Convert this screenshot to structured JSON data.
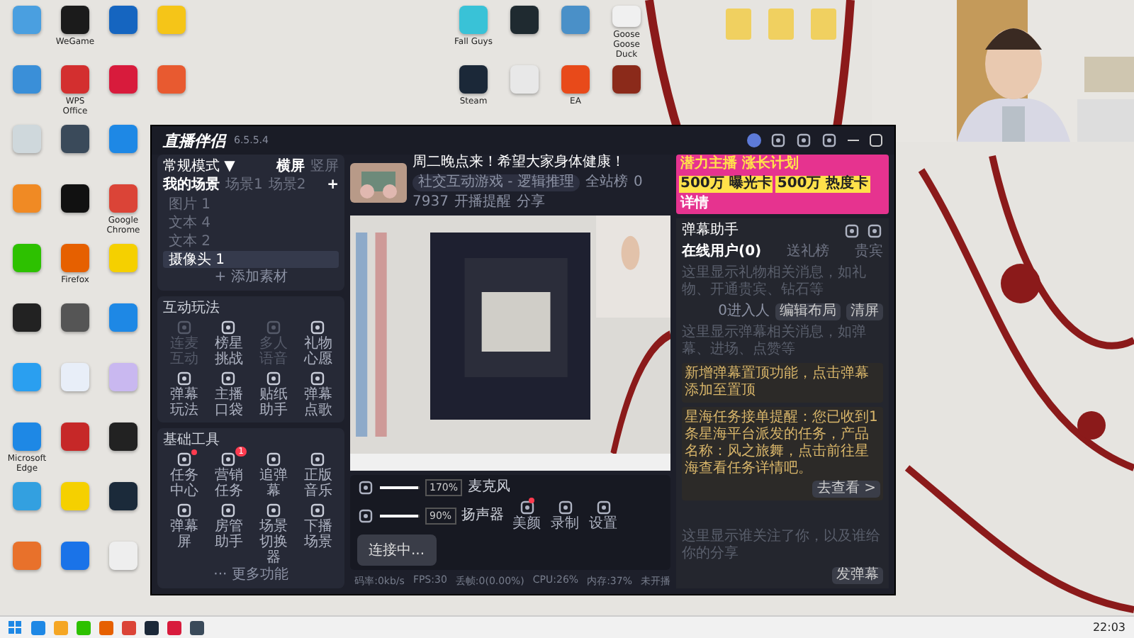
{
  "desktop": {
    "icon_columns": [
      {
        "icons": [
          {
            "color": "#4a9fe0"
          },
          {
            "color": "#3a8fd8"
          },
          {
            "color": "#cfd8dc"
          },
          {
            "color": "#f08a24"
          },
          {
            "color": "#2dc100"
          },
          {
            "color": "#222222"
          },
          {
            "color": "#2a9ff0"
          },
          {
            "color": "#1e88e5",
            "label": "Microsoft Edge"
          },
          {
            "color": "#33a0e0"
          },
          {
            "color": "#e8712b"
          }
        ]
      },
      {
        "icons": [
          {
            "color": "#1b1b1b",
            "label": "WeGame"
          },
          {
            "color": "#d32f2f",
            "label": "WPS Office"
          },
          {
            "color": "#3a4a5a"
          },
          {
            "color": "#111111"
          },
          {
            "color": "#e66000",
            "label": "Firefox"
          },
          {
            "color": "#555555"
          },
          {
            "color": "#e8eef8"
          },
          {
            "color": "#c62828"
          },
          {
            "color": "#f5d000"
          },
          {
            "color": "#1a73e8"
          }
        ]
      },
      {
        "icons": [
          {
            "color": "#1565c0"
          },
          {
            "color": "#d81b3c"
          },
          {
            "color": "#1e88e5"
          },
          {
            "color": "#db4437",
            "label": "Google Chrome"
          },
          {
            "color": "#f5d000"
          },
          {
            "color": "#1e88e5"
          },
          {
            "color": "#c9b8f0"
          },
          {
            "color": "#222222"
          },
          {
            "color": "#1b2a3a"
          },
          {
            "color": "#eeeeee"
          }
        ]
      },
      {
        "icons": [
          {
            "color": "#f5c518"
          },
          {
            "color": "#e85a30"
          }
        ]
      }
    ],
    "top_icons": [
      {
        "color": "#39c2d7",
        "label": "Fall Guys"
      },
      {
        "color": "#1f2a30"
      },
      {
        "color": "#4a90c8"
      },
      {
        "color": "#f0f0f0",
        "label": "Goose Goose Duck"
      },
      {
        "color": "#1b2838",
        "label": "Steam"
      },
      {
        "color": "#e8e8e8"
      },
      {
        "color": "#e84a1a",
        "label": "EA"
      },
      {
        "color": "#8b2a1a"
      }
    ],
    "folders": [
      {
        "color": "#f0d060"
      },
      {
        "color": "#f0d060"
      },
      {
        "color": "#f0d060"
      }
    ]
  },
  "app": {
    "title": "直播伴侣",
    "version": "6.5.5.4",
    "left": {
      "mode": "常规模式 ▼",
      "orientations": [
        {
          "label": "横屏",
          "selected": true
        },
        {
          "label": "竖屏",
          "selected": false
        }
      ],
      "scene_tabs": [
        {
          "label": "我的场景",
          "selected": true
        },
        {
          "label": "场景1",
          "selected": false
        },
        {
          "label": "场景2",
          "selected": false
        }
      ],
      "add_scene": "+",
      "sources": [
        {
          "label": "图片 1",
          "selected": false
        },
        {
          "label": "文本 4",
          "selected": false
        },
        {
          "label": "文本 2",
          "selected": false
        },
        {
          "label": "摄像头 1",
          "selected": true
        }
      ],
      "add_source": "+ 添加素材",
      "sections": [
        {
          "title": "互动玩法",
          "items": [
            {
              "label": "连麦互动",
              "disabled": true
            },
            {
              "label": "榜星挑战",
              "disabled": false
            },
            {
              "label": "多人语音",
              "disabled": true
            },
            {
              "label": "礼物心愿",
              "disabled": false
            },
            {
              "label": "弹幕玩法",
              "disabled": false
            },
            {
              "label": "主播口袋",
              "disabled": false
            },
            {
              "label": "贴纸助手",
              "disabled": false
            },
            {
              "label": "弹幕点歌",
              "disabled": false
            }
          ]
        },
        {
          "title": "基础工具",
          "items": [
            {
              "label": "任务中心",
              "disabled": false,
              "dot": true
            },
            {
              "label": "营销任务",
              "disabled": false,
              "badge": "1"
            },
            {
              "label": "追弹幕",
              "disabled": false
            },
            {
              "label": "正版音乐",
              "disabled": false
            },
            {
              "label": "弹幕屏",
              "disabled": false
            },
            {
              "label": "房管助手",
              "disabled": false
            },
            {
              "label": "场景切换器",
              "disabled": false
            },
            {
              "label": "下播场景",
              "disabled": false
            }
          ]
        }
      ],
      "more": "··· 更多功能"
    },
    "header": {
      "stream_title": "周二晚点来！希望大家身体健康！",
      "category": "社交互动游戏 - 逻辑推理",
      "remind": "开播提醒",
      "share": "分享",
      "rank": "全站榜",
      "likes": "0",
      "hearts": "7937"
    },
    "controls": {
      "mic": {
        "label": "麦克风",
        "level": 0.95,
        "value": "170%"
      },
      "speaker": {
        "label": "扬声器",
        "level": 0.95,
        "value": "90%"
      },
      "tools": [
        {
          "label": "美颜",
          "dot": true
        },
        {
          "label": "录制",
          "dot": false
        },
        {
          "label": "设置",
          "dot": false
        }
      ],
      "connect": "连接中..."
    },
    "status": [
      "码率:0kb/s",
      "FPS:30",
      "丢帧:0(0.00%)",
      "CPU:26%",
      "内存:37%",
      "未开播"
    ],
    "banner": {
      "slogan": "潜力主播 涨长计划",
      "cards": [
        "500万 曝光卡",
        "500万 热度卡"
      ],
      "details": "详情"
    },
    "chat": {
      "title": "弹幕助手",
      "tabs": [
        {
          "label": "在线用户(0)",
          "selected": true
        },
        {
          "label": "送礼榜",
          "selected": false
        },
        {
          "label": "贵宾",
          "selected": false
        }
      ],
      "gift_hint": "这里显示礼物相关消息，如礼物、开通贵宾、钻石等",
      "danmu_hint": "这里显示弹幕相关消息，如弹幕、进场、点赞等",
      "online": "0进入人",
      "edit": "编辑布局",
      "clear": "清屏",
      "notices": [
        {
          "text": "新增弹幕置顶功能，点击弹幕添加至置顶"
        },
        {
          "text": "星海任务接单提醒：您已收到1条星海平台派发的任务，产品名称：风之旅舞，点击前往星海查看任务详情吧。",
          "action": "去查看 >"
        }
      ],
      "follow_hint": "这里显示谁关注了你，以及谁给你的分享",
      "send": "发弹幕"
    }
  },
  "taskbar": {
    "apps": [
      {
        "color": "#1e88e5"
      },
      {
        "color": "#f5a623"
      },
      {
        "color": "#2dc100"
      },
      {
        "color": "#e66000"
      },
      {
        "color": "#db4437"
      },
      {
        "color": "#1b2838"
      },
      {
        "color": "#d81b3c"
      },
      {
        "color": "#3a4a5a"
      }
    ],
    "time": "22:03"
  }
}
